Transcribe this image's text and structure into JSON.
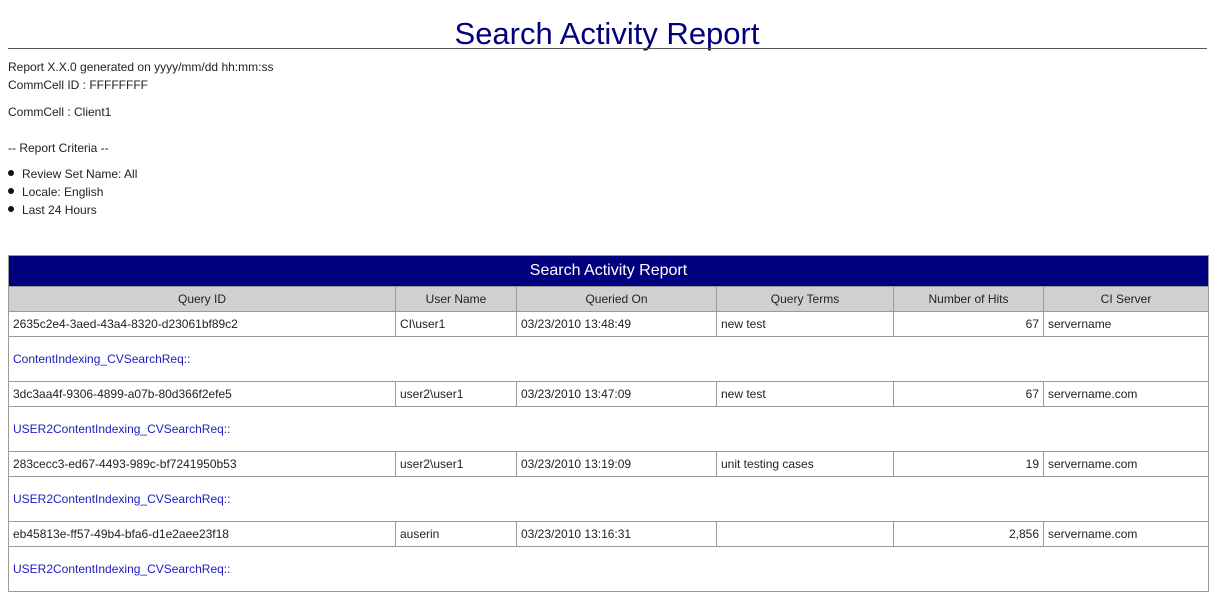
{
  "title": "Search Activity Report",
  "meta": {
    "generated": "Report X.X.0 generated on yyyy/mm/dd hh:mm:ss",
    "commcell_id": "CommCell ID : FFFFFFFF",
    "commcell": "CommCell : Client1",
    "criteria_heading": "-- Report Criteria --",
    "criteria": [
      "Review Set Name: All",
      "Locale: English",
      "Last 24 Hours"
    ]
  },
  "table": {
    "caption": "Search Activity Report",
    "headers": [
      "Query ID",
      "User Name",
      "Queried On",
      "Query Terms",
      "Number of Hits",
      "CI Server"
    ],
    "rows": [
      {
        "query_id": "2635c2e4-3aed-43a4-8320-d23061bf89c2",
        "user": "CI\\user1",
        "queried_on": "03/23/2010 13:48:49",
        "terms": "new test",
        "hits": "67",
        "server": "servername",
        "request": "ContentIndexing_CVSearchReq::"
      },
      {
        "query_id": "3dc3aa4f-9306-4899-a07b-80d366f2efe5",
        "user": "user2\\user1",
        "queried_on": "03/23/2010 13:47:09",
        "terms": "new test",
        "hits": "67",
        "server": "servername.com",
        "request": "USER2ContentIndexing_CVSearchReq::"
      },
      {
        "query_id": "283cecc3-ed67-4493-989c-bf7241950b53",
        "user": "user2\\user1",
        "queried_on": "03/23/2010 13:19:09",
        "terms": "unit testing cases",
        "hits": "19",
        "server": "servername.com",
        "request": "USER2ContentIndexing_CVSearchReq::"
      },
      {
        "query_id": "eb45813e-ff57-49b4-bfa6-d1e2aee23f18",
        "user": "auserin",
        "queried_on": "03/23/2010 13:16:31",
        "terms": "",
        "hits": "2,856",
        "server": "servername.com",
        "request": "USER2ContentIndexing_CVSearchReq::"
      }
    ]
  }
}
